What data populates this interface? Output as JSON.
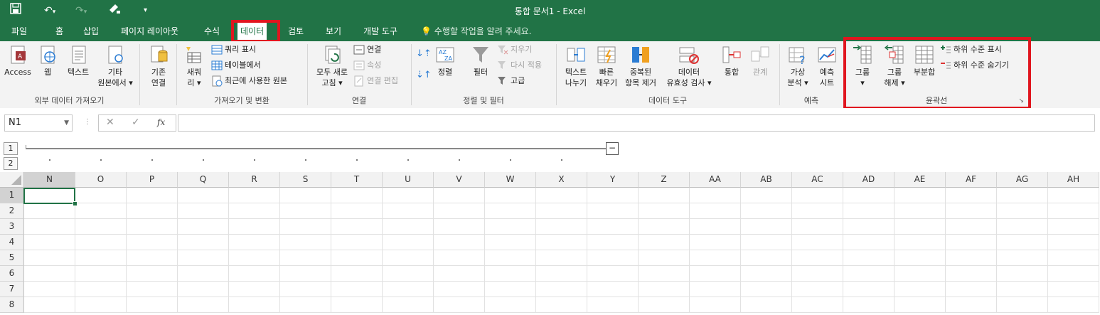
{
  "title": "통합 문서1 - Excel",
  "qat": {
    "save_icon": "save-icon",
    "undo_icon": "undo-icon",
    "redo_icon": "redo-icon",
    "brush_icon": "format-painter-icon",
    "customize_icon": "customize-qat-icon"
  },
  "tabs": [
    {
      "label": "파일"
    },
    {
      "label": "홈"
    },
    {
      "label": "삽입"
    },
    {
      "label": "페이지 레이아웃"
    },
    {
      "label": "수식"
    },
    {
      "label": "데이터"
    },
    {
      "label": "검토"
    },
    {
      "label": "보기"
    },
    {
      "label": "개발 도구"
    }
  ],
  "active_tab": "데이터",
  "tell_me": "수행할 작업을 알려 주세요.",
  "ribbon": {
    "get_external": {
      "label": "외부 데이터 가져오기",
      "access_line1": "Access",
      "access_line2": "",
      "web_line1": "웹",
      "web_line2": "",
      "text_line1": "텍스트",
      "text_line2": "",
      "other_line1": "기타",
      "other_line2": "원본에서 ▾"
    },
    "existing": {
      "line1": "기존",
      "line2": "연결"
    },
    "get_transform": {
      "label": "가져오기 및 변환",
      "new_query_line1": "새쿼",
      "new_query_line2": "리 ▾",
      "show_queries": "쿼리 표시",
      "from_table": "테이블에서",
      "recent_sources": "최근에 사용한 원본"
    },
    "connections": {
      "label": "연결",
      "refresh_line1": "모두 새로",
      "refresh_line2": "고침 ▾",
      "connections": "연결",
      "properties": "속성",
      "edit_links": "연결 편집"
    },
    "sort_filter": {
      "label": "정렬 및 필터",
      "sort": "정렬",
      "filter": "필터",
      "clear": "지우기",
      "reapply": "다시 적용",
      "advanced": "고급"
    },
    "data_tools": {
      "label": "데이터 도구",
      "text_to_columns_line1": "텍스트",
      "text_to_columns_line2": "나누기",
      "flash_fill_line1": "빠른",
      "flash_fill_line2": "채우기",
      "remove_dup_line1": "중복된",
      "remove_dup_line2": "항목 제거",
      "validation_line1": "데이터",
      "validation_line2": "유효성 검사 ▾",
      "consolidate": "통합",
      "relationships": "관계"
    },
    "forecast": {
      "label": "예측",
      "whatif_line1": "가상",
      "whatif_line2": "분석 ▾",
      "sheet_line1": "예측",
      "sheet_line2": "시트"
    },
    "outline": {
      "label": "윤곽선",
      "group_line1": "그룹",
      "group_line2": "▾",
      "ungroup_line1": "그룹",
      "ungroup_line2": "해제 ▾",
      "subtotal": "부분합",
      "show_detail": "하위 수준 표시",
      "hide_detail": "하위 수준 숨기기"
    }
  },
  "formula_bar": {
    "name_box": "N1",
    "formula": "",
    "fx": "fx",
    "cancel": "✕",
    "enter": "✓"
  },
  "outline_levels": [
    "1",
    "2"
  ],
  "collapse_button": "−",
  "columns": [
    "N",
    "O",
    "P",
    "Q",
    "R",
    "S",
    "T",
    "U",
    "V",
    "W",
    "X",
    "Y",
    "Z",
    "AA",
    "AB",
    "AC",
    "AD",
    "AE",
    "AF",
    "AG",
    "AH"
  ],
  "rows": [
    "1",
    "2",
    "3",
    "4",
    "5",
    "6",
    "7",
    "8"
  ],
  "accent": "#217346",
  "highlight": "#e0161f"
}
